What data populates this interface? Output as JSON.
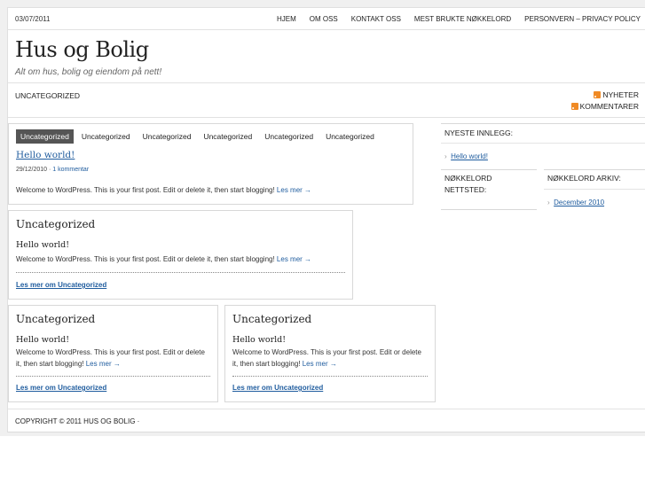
{
  "topbar": {
    "date": "03/07/2011",
    "nav": [
      "HJEM",
      "OM OSS",
      "KONTAKT OSS",
      "MEST BRUKTE NØKKELORD",
      "PERSONVERN – PRIVACY POLICY"
    ]
  },
  "site": {
    "title": "Hus og Bolig",
    "tagline": "Alt om hus, bolig og eiendom på nett!"
  },
  "catbar": {
    "category": "UNCATEGORIZED",
    "feed_news": "NYHETER",
    "feed_comments": "KOMMENTARER"
  },
  "featured": {
    "tabs": [
      "Uncategorized",
      "Uncategorized",
      "Uncategorized",
      "Uncategorized",
      "Uncategorized",
      "Uncategorized"
    ],
    "post_title": "Hello world!",
    "date": "29/12/2010",
    "meta_sep": "·",
    "comments": "1 kommentar",
    "excerpt": "Welcome to WordPress. This is your first post. Edit or delete it, then start blogging!",
    "read_more": "Les mer →"
  },
  "card_wide": {
    "heading": "Uncategorized",
    "post_title": "Hello world!",
    "excerpt": "Welcome to WordPress. This is your first post. Edit or delete it, then start blogging!",
    "read_more": "Les mer →",
    "more_link": "Les mer om Uncategorized"
  },
  "cards": [
    {
      "heading": "Uncategorized",
      "post_title": "Hello world!",
      "excerpt": "Welcome to WordPress. This is your first post. Edit or delete it, then start blogging!",
      "read_more": "Les mer →",
      "more_link": "Les mer om Uncategorized"
    },
    {
      "heading": "Uncategorized",
      "post_title": "Hello world!",
      "excerpt": "Welcome to WordPress. This is your first post. Edit or delete it, then start blogging!",
      "read_more": "Les mer →",
      "more_link": "Les mer om Uncategorized"
    }
  ],
  "sidebar": {
    "recent_heading": "NYESTE INNLEGG:",
    "recent_items": [
      "Hello world!"
    ],
    "keywords_heading": "NØKKELORD NETTSTED:",
    "archive_heading": "NØKKELORD ARKIV:",
    "archive_items": [
      "December 2010"
    ]
  },
  "footer": {
    "copyright": "COPYRIGHT © 2011 HUS OG BOLIG ·"
  },
  "colors": {
    "link": "#1f5c9e",
    "active_tab": "#555555",
    "rss": "#f08a24"
  }
}
